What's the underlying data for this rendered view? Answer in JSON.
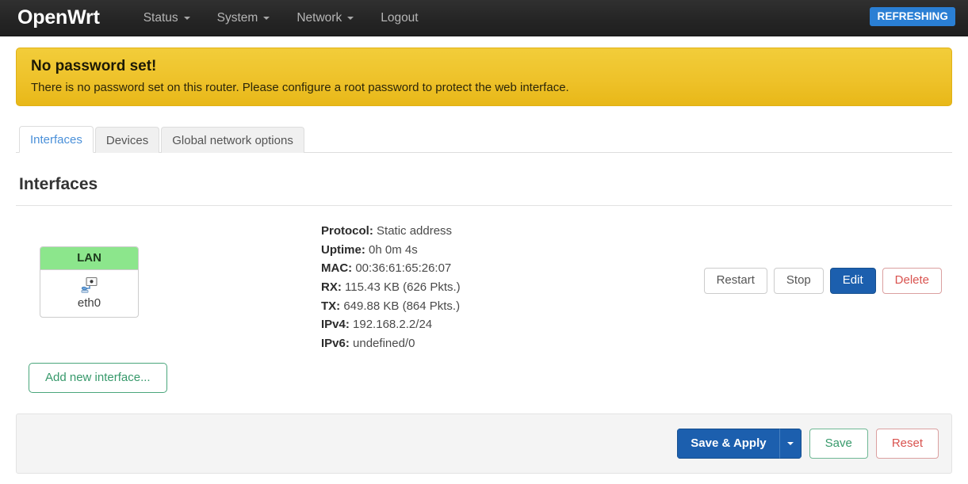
{
  "navbar": {
    "brand": "OpenWrt",
    "items": [
      {
        "label": "Status",
        "has_caret": true
      },
      {
        "label": "System",
        "has_caret": true
      },
      {
        "label": "Network",
        "has_caret": true
      },
      {
        "label": "Logout",
        "has_caret": false
      }
    ],
    "refresh_badge": "REFRESHING",
    "refresh_badge_color": "#2a7fd4"
  },
  "banner": {
    "title": "No password set!",
    "text": "There is no password set on this router. Please configure a root password to protect the web interface.",
    "color": "#eec22a"
  },
  "tabs": [
    {
      "label": "Interfaces",
      "active": true
    },
    {
      "label": "Devices",
      "active": false
    },
    {
      "label": "Global network options",
      "active": false
    }
  ],
  "page": {
    "title": "Interfaces"
  },
  "interface": {
    "badge": {
      "name": "LAN",
      "device": "eth0",
      "header_color": "#8ce68c"
    },
    "details": [
      {
        "label": "Protocol:",
        "value": "Static address"
      },
      {
        "label": "Uptime:",
        "value": "0h 0m 4s"
      },
      {
        "label": "MAC:",
        "value": "00:36:61:65:26:07"
      },
      {
        "label": "RX:",
        "value": "115.43 KB (626 Pkts.)"
      },
      {
        "label": "TX:",
        "value": "649.88 KB (864 Pkts.)"
      },
      {
        "label": "IPv4:",
        "value": "192.168.2.2/24"
      },
      {
        "label": "IPv6:",
        "value": "undefined/0"
      }
    ],
    "actions": {
      "restart": "Restart",
      "stop": "Stop",
      "edit": "Edit",
      "delete": "Delete"
    }
  },
  "add_interface_label": "Add new interface...",
  "footer": {
    "save_apply": "Save & Apply",
    "save": "Save",
    "reset": "Reset"
  }
}
